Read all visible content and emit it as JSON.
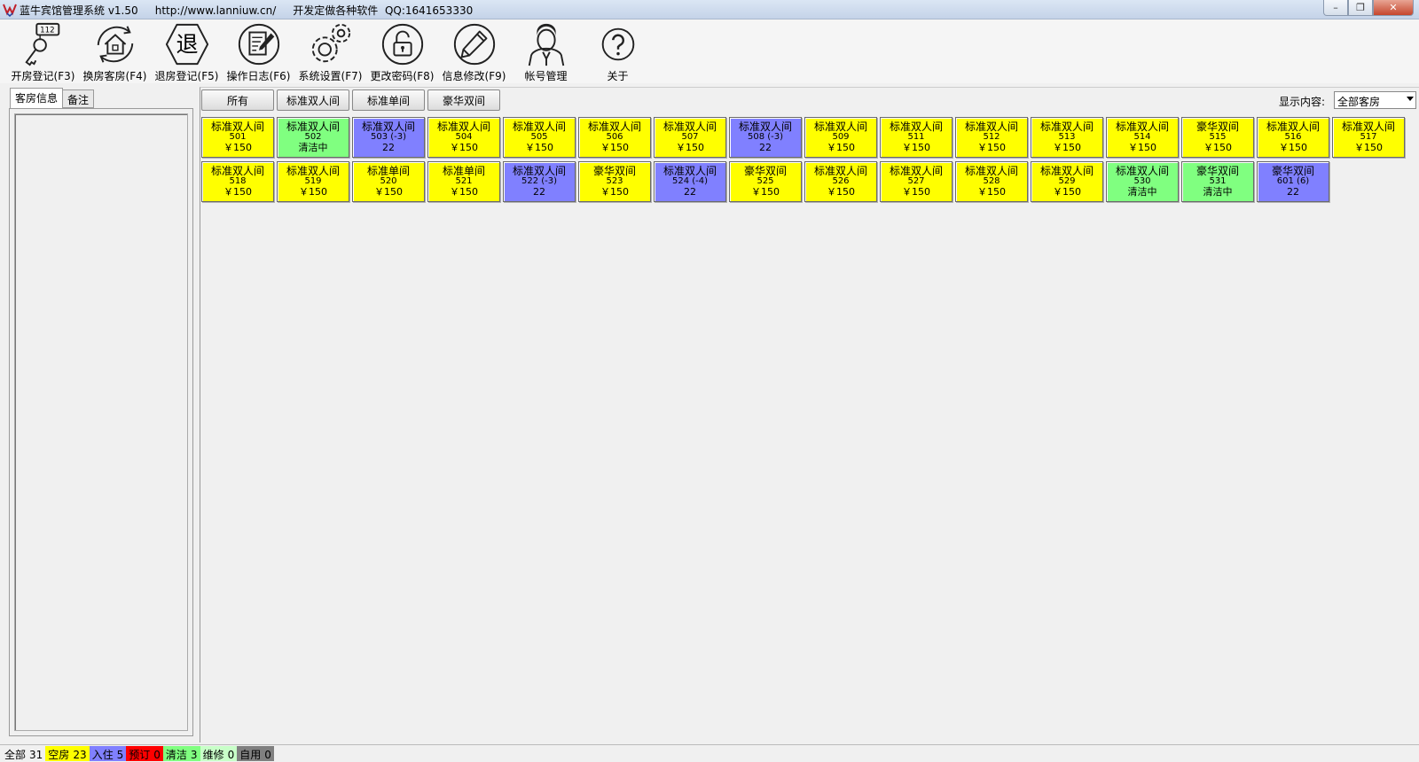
{
  "window": {
    "title": "蓝牛宾馆管理系统 v1.50     http://www.lanniuw.cn/     开发定做各种软件  QQ:1641653330"
  },
  "toolbar": [
    {
      "label": "开房登记(F3)",
      "icon": "key-tag-icon"
    },
    {
      "label": "换房客房(F4)",
      "icon": "house-refresh-icon"
    },
    {
      "label": "退房登记(F5)",
      "icon": "checkout-hexagon-icon"
    },
    {
      "label": "操作日志(F6)",
      "icon": "log-edit-icon"
    },
    {
      "label": "系统设置(F7)",
      "icon": "gear-icon"
    },
    {
      "label": "更改密码(F8)",
      "icon": "lock-icon"
    },
    {
      "label": "信息修改(F9)",
      "icon": "pencil-icon"
    },
    {
      "label": "帐号管理",
      "icon": "user-icon"
    },
    {
      "label": "关于",
      "icon": "help-icon"
    }
  ],
  "checkout_glyph": "退",
  "left_tabs": [
    "客房信息",
    "备注"
  ],
  "filters": [
    "所有",
    "标准双人间",
    "标准单间",
    "豪华双间"
  ],
  "display": {
    "label": "显示内容:",
    "value": "全部客房"
  },
  "rooms": [
    {
      "type": "标准双人间",
      "num": "501",
      "info": "￥150",
      "status": "empty"
    },
    {
      "type": "标准双人间",
      "num": "502",
      "info": "清洁中",
      "status": "cleaning"
    },
    {
      "type": "标准双人间",
      "num": "503 (-3)",
      "info": "22",
      "status": "occupied"
    },
    {
      "type": "标准双人间",
      "num": "504",
      "info": "￥150",
      "status": "empty"
    },
    {
      "type": "标准双人间",
      "num": "505",
      "info": "￥150",
      "status": "empty"
    },
    {
      "type": "标准双人间",
      "num": "506",
      "info": "￥150",
      "status": "empty"
    },
    {
      "type": "标准双人间",
      "num": "507",
      "info": "￥150",
      "status": "empty"
    },
    {
      "type": "标准双人间",
      "num": "508 (-3)",
      "info": "22",
      "status": "occupied"
    },
    {
      "type": "标准双人间",
      "num": "509",
      "info": "￥150",
      "status": "empty"
    },
    {
      "type": "标准双人间",
      "num": "511",
      "info": "￥150",
      "status": "empty"
    },
    {
      "type": "标准双人间",
      "num": "512",
      "info": "￥150",
      "status": "empty"
    },
    {
      "type": "标准双人间",
      "num": "513",
      "info": "￥150",
      "status": "empty"
    },
    {
      "type": "标准双人间",
      "num": "514",
      "info": "￥150",
      "status": "empty"
    },
    {
      "type": "豪华双间",
      "num": "515",
      "info": "￥150",
      "status": "empty"
    },
    {
      "type": "标准双人间",
      "num": "516",
      "info": "￥150",
      "status": "empty"
    },
    {
      "type": "标准双人间",
      "num": "517",
      "info": "￥150",
      "status": "empty"
    },
    {
      "type": "标准双人间",
      "num": "518",
      "info": "￥150",
      "status": "empty"
    },
    {
      "type": "标准双人间",
      "num": "519",
      "info": "￥150",
      "status": "empty"
    },
    {
      "type": "标准单间",
      "num": "520",
      "info": "￥150",
      "status": "empty"
    },
    {
      "type": "标准单间",
      "num": "521",
      "info": "￥150",
      "status": "empty"
    },
    {
      "type": "标准双人间",
      "num": "522 (-3)",
      "info": "22",
      "status": "occupied"
    },
    {
      "type": "豪华双间",
      "num": "523",
      "info": "￥150",
      "status": "empty"
    },
    {
      "type": "标准双人间",
      "num": "524 (-4)",
      "info": "22",
      "status": "occupied"
    },
    {
      "type": "豪华双间",
      "num": "525",
      "info": "￥150",
      "status": "empty"
    },
    {
      "type": "标准双人间",
      "num": "526",
      "info": "￥150",
      "status": "empty"
    },
    {
      "type": "标准双人间",
      "num": "527",
      "info": "￥150",
      "status": "empty"
    },
    {
      "type": "标准双人间",
      "num": "528",
      "info": "￥150",
      "status": "empty"
    },
    {
      "type": "标准双人间",
      "num": "529",
      "info": "￥150",
      "status": "empty"
    },
    {
      "type": "标准双人间",
      "num": "530",
      "info": "清洁中",
      "status": "cleaning"
    },
    {
      "type": "豪华双间",
      "num": "531",
      "info": "清洁中",
      "status": "cleaning"
    },
    {
      "type": "豪华双间",
      "num": "601 (6)",
      "info": "22",
      "status": "occupied"
    }
  ],
  "status_bar": [
    {
      "label": "全部",
      "count": "31",
      "color": "#f0f0f0",
      "text_color": "#000000"
    },
    {
      "label": "空房",
      "count": "23",
      "color": "#ffff00",
      "text_color": "#000000"
    },
    {
      "label": "入住",
      "count": "5",
      "color": "#8080ff",
      "text_color": "#000000"
    },
    {
      "label": "预订",
      "count": "0",
      "color": "#ff0000",
      "text_color": "#000000"
    },
    {
      "label": "清洁",
      "count": "3",
      "color": "#80ff80",
      "text_color": "#000000"
    },
    {
      "label": "维修",
      "count": "0",
      "color": "#c8ffc8",
      "text_color": "#000000"
    },
    {
      "label": "自用",
      "count": "0",
      "color": "#808080",
      "text_color": "#000000"
    }
  ]
}
